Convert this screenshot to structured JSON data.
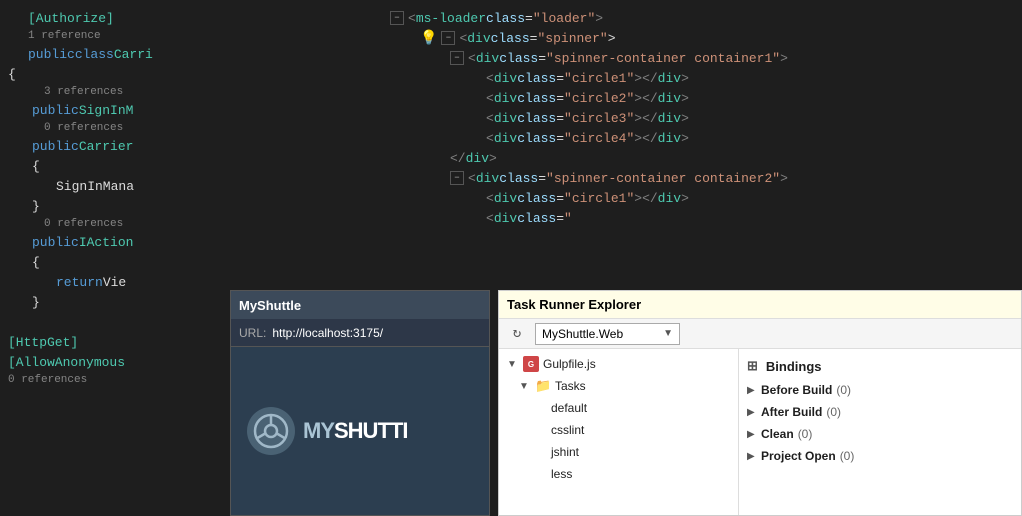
{
  "editor": {
    "left_panel": {
      "lines": [
        {
          "id": 1,
          "indent": 0,
          "has_collapse": false,
          "content": "[Authorize]",
          "color": "cyan",
          "ref": ""
        },
        {
          "id": 2,
          "indent": 0,
          "has_collapse": false,
          "content": "1 reference",
          "color": "gray",
          "ref": ""
        },
        {
          "id": 3,
          "indent": 0,
          "has_collapse": false,
          "content": "public class Carri",
          "color": "mixed",
          "ref": ""
        },
        {
          "id": 4,
          "indent": 0,
          "has_collapse": false,
          "content": "{",
          "color": "white",
          "ref": ""
        },
        {
          "id": 5,
          "indent": 1,
          "has_collapse": false,
          "content": "3 references",
          "color": "gray",
          "ref": ""
        },
        {
          "id": 6,
          "indent": 1,
          "has_collapse": false,
          "content": "public SignInM",
          "color": "mixed",
          "ref": ""
        },
        {
          "id": 7,
          "indent": 1,
          "has_collapse": false,
          "content": "0 references",
          "color": "gray",
          "ref": ""
        },
        {
          "id": 8,
          "indent": 1,
          "has_collapse": false,
          "content": "public Carrier",
          "color": "mixed",
          "ref": ""
        },
        {
          "id": 9,
          "indent": 1,
          "has_collapse": false,
          "content": "{",
          "color": "white",
          "ref": ""
        },
        {
          "id": 10,
          "indent": 2,
          "has_collapse": false,
          "content": "SignInMana",
          "color": "white",
          "ref": ""
        },
        {
          "id": 11,
          "indent": 1,
          "has_collapse": false,
          "content": "}",
          "color": "white",
          "ref": ""
        },
        {
          "id": 12,
          "indent": 1,
          "has_collapse": false,
          "content": "0 references",
          "color": "gray",
          "ref": ""
        },
        {
          "id": 13,
          "indent": 1,
          "has_collapse": false,
          "content": "public IAction",
          "color": "mixed",
          "ref": ""
        },
        {
          "id": 14,
          "indent": 1,
          "has_collapse": false,
          "content": "{",
          "color": "white",
          "ref": ""
        },
        {
          "id": 15,
          "indent": 2,
          "has_collapse": false,
          "content": "return Vie",
          "color": "mixed",
          "ref": ""
        },
        {
          "id": 16,
          "indent": 1,
          "has_collapse": false,
          "content": "}",
          "color": "white",
          "ref": ""
        },
        {
          "id": 17,
          "indent": 0,
          "has_collapse": false,
          "content": "",
          "color": "white",
          "ref": ""
        },
        {
          "id": 18,
          "indent": 0,
          "has_collapse": false,
          "content": "[HttpGet]",
          "color": "cyan",
          "ref": ""
        },
        {
          "id": 19,
          "indent": 0,
          "has_collapse": false,
          "content": "[AllowAnonymous",
          "color": "cyan",
          "ref": ""
        },
        {
          "id": 20,
          "indent": 0,
          "has_collapse": false,
          "content": "0 references",
          "color": "gray",
          "ref": ""
        }
      ]
    },
    "right_panel": {
      "lines": [
        {
          "id": 1,
          "indent": 4,
          "content": "<ms-loader class=\"loader\">",
          "has_collapse": true
        },
        {
          "id": 2,
          "indent": 6,
          "has_lightbulb": true,
          "content": "<div class=\"spinner\"",
          "has_collapse": true
        },
        {
          "id": 3,
          "indent": 8,
          "content": "<div class=\"spinner-container container1\">",
          "has_collapse": true
        },
        {
          "id": 4,
          "indent": 10,
          "content": "<div class=\"circle1\"></div>",
          "has_collapse": false
        },
        {
          "id": 5,
          "indent": 10,
          "content": "<div class=\"circle2\"></div>",
          "has_collapse": false
        },
        {
          "id": 6,
          "indent": 10,
          "content": "<div class=\"circle3\"></div>",
          "has_collapse": false
        },
        {
          "id": 7,
          "indent": 10,
          "content": "<div class=\"circle4\"></div>",
          "has_collapse": false
        },
        {
          "id": 8,
          "indent": 8,
          "content": "</div>",
          "has_collapse": false
        },
        {
          "id": 9,
          "indent": 8,
          "content": "<div class=\"spinner-container container2\">",
          "has_collapse": true
        },
        {
          "id": 10,
          "indent": 10,
          "content": "<div class=\"circle1\"></div>",
          "has_collapse": false
        },
        {
          "id": 11,
          "indent": 10,
          "content": "<div class=\"",
          "has_collapse": false
        }
      ]
    }
  },
  "myshuttle": {
    "title": "MyShuttle",
    "url_label": "URL:",
    "url_value": "http://localhost:3175/",
    "logo_my": "MY",
    "logo_shuttle": "SHUTTI"
  },
  "task_runner": {
    "title": "Task Runner Explorer",
    "project_name": "MyShuttle.Web",
    "refresh_icon": "↻",
    "bindings_label": "Bindings",
    "tree": [
      {
        "id": 1,
        "level": 0,
        "label": "Gulpfile.js",
        "type": "gulpfile",
        "arrow": "▼"
      },
      {
        "id": 2,
        "level": 1,
        "label": "Tasks",
        "type": "folder",
        "arrow": "▼"
      },
      {
        "id": 3,
        "level": 2,
        "label": "default",
        "type": "task",
        "arrow": ""
      },
      {
        "id": 4,
        "level": 2,
        "label": "csslint",
        "type": "task",
        "arrow": ""
      },
      {
        "id": 5,
        "level": 2,
        "label": "jshint",
        "type": "task",
        "arrow": ""
      },
      {
        "id": 6,
        "level": 2,
        "label": "less",
        "type": "task",
        "arrow": ""
      }
    ],
    "bindings": [
      {
        "id": 1,
        "label": "Before Build",
        "count": "(0)",
        "arrow": "▶"
      },
      {
        "id": 2,
        "label": "After Build",
        "count": "(0)",
        "arrow": "▶"
      },
      {
        "id": 3,
        "label": "Clean",
        "count": "(0)",
        "arrow": "▶"
      },
      {
        "id": 4,
        "label": "Project Open",
        "count": "(0)",
        "arrow": "▶"
      }
    ]
  }
}
